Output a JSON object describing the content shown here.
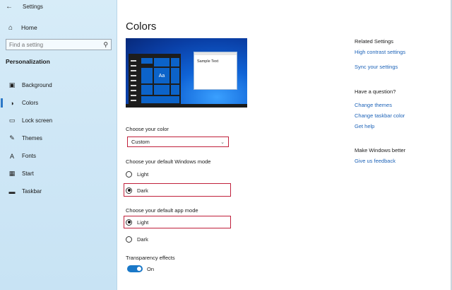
{
  "window": {
    "title": "Settings",
    "back_icon": "back-arrow-icon"
  },
  "sidebar": {
    "home_label": "Home",
    "search_placeholder": "Find a setting",
    "section": "Personalization",
    "items": [
      {
        "label": "Background",
        "icon": "picture-icon"
      },
      {
        "label": "Colors",
        "icon": "palette-icon",
        "active": true
      },
      {
        "label": "Lock screen",
        "icon": "lock-screen-icon"
      },
      {
        "label": "Themes",
        "icon": "brush-icon"
      },
      {
        "label": "Fonts",
        "icon": "font-icon"
      },
      {
        "label": "Start",
        "icon": "start-icon"
      },
      {
        "label": "Taskbar",
        "icon": "taskbar-icon"
      }
    ]
  },
  "main": {
    "title": "Colors",
    "preview": {
      "tile_text": "Aa",
      "window_text": "Sample Text"
    },
    "choose_color": {
      "label": "Choose your color",
      "value": "Custom"
    },
    "windows_mode": {
      "label": "Choose your default Windows mode",
      "options": [
        "Light",
        "Dark"
      ],
      "selected": "Dark"
    },
    "app_mode": {
      "label": "Choose your default app mode",
      "options": [
        "Light",
        "Dark"
      ],
      "selected": "Light"
    },
    "transparency": {
      "label": "Transparency effects",
      "state": "On"
    }
  },
  "right": {
    "related_heading": "Related Settings",
    "related_links": [
      "High contrast settings",
      "Sync your settings"
    ],
    "question_heading": "Have a question?",
    "question_links": [
      "Change themes",
      "Change taskbar color",
      "Get help"
    ],
    "better_heading": "Make Windows better",
    "better_links": [
      "Give us feedback"
    ]
  },
  "colors": {
    "accent": "#1a78c8",
    "highlight": "#c0203b",
    "link": "#1d63b8",
    "sidebar_bg": "#d7ecf8"
  }
}
